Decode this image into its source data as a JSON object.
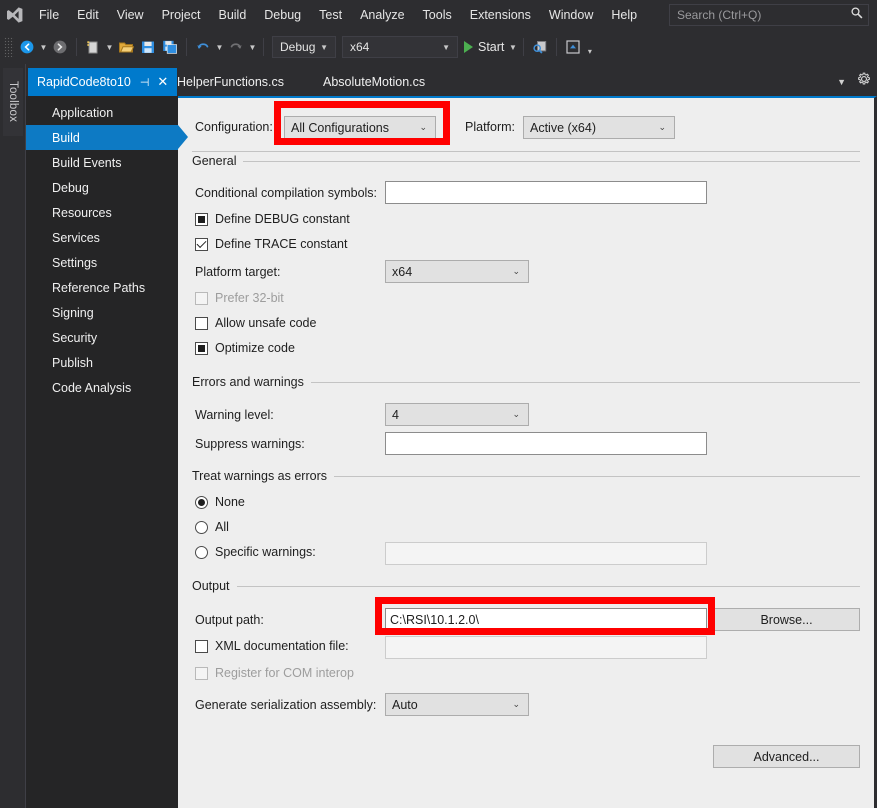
{
  "window": {
    "logo_icon": "visual-studio-logo",
    "menus": [
      "File",
      "Edit",
      "View",
      "Project",
      "Build",
      "Debug",
      "Test",
      "Analyze",
      "Tools",
      "Extensions",
      "Window",
      "Help"
    ],
    "search": {
      "placeholder": "Search (Ctrl+Q)",
      "icon": "search-icon"
    }
  },
  "toolbar": {
    "nav_back_icon": "navigate-backward-icon",
    "nav_forward_icon": "navigate-forward-icon",
    "new_project_icon": "new-project-icon",
    "open_file_icon": "open-file-icon",
    "save_icon": "save-icon",
    "save_all_icon": "save-all-icon",
    "undo_icon": "undo-icon",
    "redo_icon": "redo-icon",
    "configuration": "Debug",
    "platform": "x64",
    "start_label": "Start",
    "start_icon": "play-icon",
    "search_solution_icon": "find-icon",
    "preview_icon": "preview-selected-items-icon",
    "overflow_icon": "toolbar-overflow-icon"
  },
  "rail": {
    "toolbox_label": "Toolbox"
  },
  "tabs": {
    "items": [
      {
        "label": "RapidCode8to10",
        "active": true,
        "pin_icon": "pin-icon",
        "close_icon": "close-icon"
      },
      {
        "label": "HelperFunctions.cs",
        "active": false
      },
      {
        "label": "AbsoluteMotion.cs",
        "active": false
      }
    ],
    "overflow_icon": "chevron-down-icon",
    "settings_icon": "gear-icon"
  },
  "nav": {
    "items": [
      {
        "label": "Application",
        "selected": false
      },
      {
        "label": "Build",
        "selected": true
      },
      {
        "label": "Build Events",
        "selected": false
      },
      {
        "label": "Debug",
        "selected": false
      },
      {
        "label": "Resources",
        "selected": false
      },
      {
        "label": "Services",
        "selected": false
      },
      {
        "label": "Settings",
        "selected": false
      },
      {
        "label": "Reference Paths",
        "selected": false
      },
      {
        "label": "Signing",
        "selected": false
      },
      {
        "label": "Security",
        "selected": false
      },
      {
        "label": "Publish",
        "selected": false
      },
      {
        "label": "Code Analysis",
        "selected": false
      }
    ]
  },
  "page": {
    "configuration_label": "Configuration:",
    "configuration_value": "All Configurations",
    "platform_label": "Platform:",
    "platform_value": "Active (x64)",
    "sections": {
      "general": "General",
      "errors_and_warnings": "Errors and warnings",
      "treat_warnings_as_errors": "Treat warnings as errors",
      "output": "Output"
    },
    "general": {
      "conditional_symbols_label": "Conditional compilation symbols:",
      "conditional_symbols_value": "",
      "define_debug_label": "Define DEBUG constant",
      "define_debug_state": "indeterminate",
      "define_trace_label": "Define TRACE constant",
      "define_trace_state": "checked",
      "platform_target_label": "Platform target:",
      "platform_target_value": "x64",
      "prefer_32bit_label": "Prefer 32-bit",
      "prefer_32bit_state": "unchecked-disabled",
      "allow_unsafe_label": "Allow unsafe code",
      "allow_unsafe_state": "unchecked",
      "optimize_code_label": "Optimize code",
      "optimize_code_state": "indeterminate"
    },
    "warnings": {
      "warning_level_label": "Warning level:",
      "warning_level_value": "4",
      "suppress_warnings_label": "Suppress warnings:",
      "suppress_warnings_value": "",
      "none_label": "None",
      "all_label": "All",
      "specific_label": "Specific warnings:",
      "specific_value": "",
      "selected_option": "None"
    },
    "output": {
      "output_path_label": "Output path:",
      "output_path_value": "C:\\RSI\\10.1.2.0\\",
      "browse_label": "Browse...",
      "xml_doc_label": "XML documentation file:",
      "xml_doc_state": "unchecked",
      "xml_doc_value": "",
      "com_interop_label": "Register for COM interop",
      "com_interop_state": "unchecked-disabled",
      "serialization_label": "Generate serialization assembly:",
      "serialization_value": "Auto"
    },
    "advanced_label": "Advanced..."
  },
  "annotations": {
    "highlight_color": "#ff0000",
    "boxes": [
      "configuration-dropdown-highlight",
      "output-path-highlight"
    ]
  },
  "colors": {
    "accent": "#007acc",
    "nav_selected": "#0d7ac4",
    "chrome": "#2d2d30",
    "panel": "#eeeeee"
  }
}
